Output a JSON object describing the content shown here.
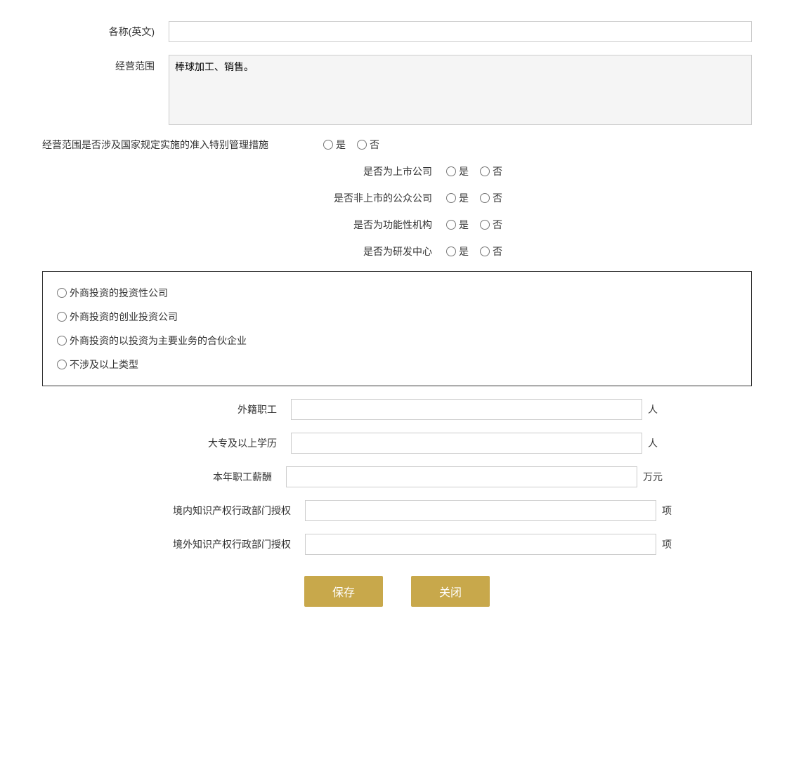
{
  "form": {
    "name_en_label": "各称(英文)",
    "name_en_placeholder": "",
    "name_en_value": "",
    "business_scope_label": "经营范围",
    "business_scope_value": "棒球加工、销售。",
    "special_management_label": "经营范围是否涉及国家规定实施的准入特别管理措施",
    "yes_label": "是",
    "no_label": "否",
    "listed_company_label": "是否为上市公司",
    "non_listed_public_label": "是否非上市的公众公司",
    "functional_institution_label": "是否为功能性机构",
    "rd_center_label": "是否为研发中心",
    "investment_company_option": "外商投资的投资性公司",
    "venture_capital_option": "外商投资的创业投资公司",
    "partnership_option": "外商投资的以投资为主要业务的合伙企业",
    "not_applicable_option": "不涉及以上类型",
    "foreign_workers_label": "外籍职工",
    "foreign_workers_value": "",
    "foreign_workers_unit": "人",
    "college_degree_label": "大专及以上学历",
    "college_degree_value": "",
    "college_degree_unit": "人",
    "annual_salary_label": "本年职工薪酬",
    "annual_salary_value": "",
    "annual_salary_unit": "万元",
    "domestic_ip_label": "境内知识产权行政部门授权",
    "domestic_ip_value": "",
    "domestic_ip_unit": "项",
    "foreign_ip_label": "境外知识产权行政部门授权",
    "foreign_ip_value": "",
    "foreign_ip_unit": "项",
    "save_button": "保存",
    "close_button": "关闭"
  }
}
